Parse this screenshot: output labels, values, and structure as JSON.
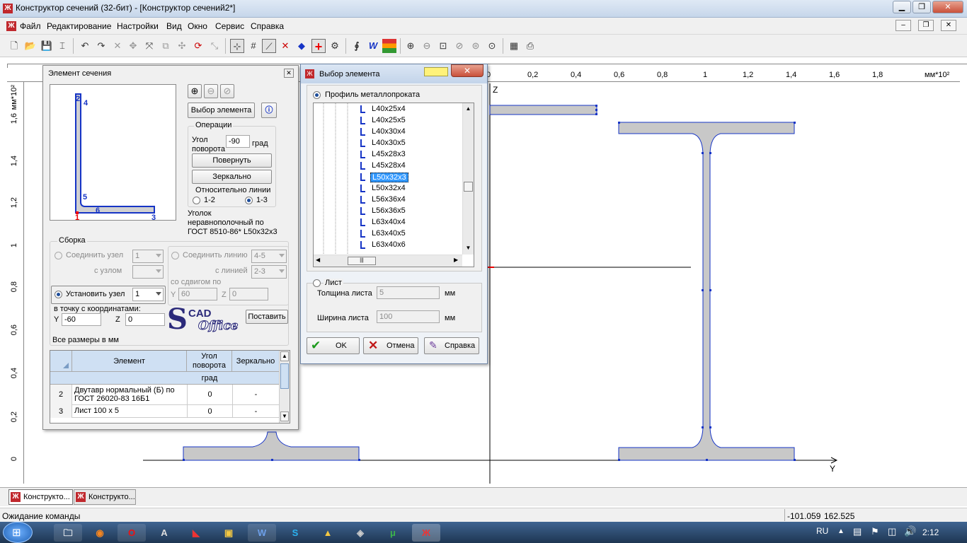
{
  "window": {
    "title": "Конструктор сечений (32-бит) - [Конструктор сечений2*]"
  },
  "menu": [
    "Файл",
    "Редактирование",
    "Настройки",
    "Вид",
    "Окно",
    "Сервис",
    "Справка"
  ],
  "ruler": {
    "x_ticks": [
      "0",
      "0,2",
      "0,4",
      "0,6",
      "0,8",
      "1",
      "1,2",
      "1,4",
      "1,6",
      "1,8"
    ],
    "x_unit": "мм*10²",
    "y_ticks": [
      "1,6",
      "1,4",
      "1,2",
      "1",
      "0,8",
      "0,6",
      "0,4",
      "0,2",
      "0"
    ],
    "y_unit": "мм*10²",
    "axis_z": "Z",
    "axis_y": "Y"
  },
  "element_panel": {
    "title": "Элемент сечения",
    "preview_nodes": [
      "2",
      "4",
      "5",
      "6",
      "1",
      "3"
    ],
    "select_button": "Выбор элемента",
    "operations_label": "Операции",
    "angle_label_1": "Угол",
    "angle_label_2": "поворота",
    "angle_value": "-90",
    "angle_unit": "град",
    "rotate_button": "Повернуть",
    "mirror_button": "Зеркально",
    "relative_label": "Относительно линии",
    "radio_12": "1-2",
    "radio_13": "1-3",
    "description_1": "Уголок",
    "description_2": "неравнополочный по",
    "description_3": "ГОСТ 8510-86* L50x32x3",
    "assembly_label": "Сборка",
    "join_node_label": "Соединить узел",
    "join_node_value": "1",
    "with_node_label": "с узлом",
    "join_line_label": "Соединить линию",
    "join_line_value": "4-5",
    "with_line_label": "с линией",
    "with_line_value": "2-3",
    "shift_label": "со сдвигом по",
    "shift_y_label": "Y",
    "shift_y_value": "60",
    "shift_z_label": "Z",
    "shift_z_value": "0",
    "set_node_label": "Установить узел",
    "set_node_value": "1",
    "to_point_label": "в точку с координатами:",
    "coord_y_label": "Y",
    "coord_y_value": "-60",
    "coord_z_label": "Z",
    "coord_z_value": "0",
    "logo_top": "CAD",
    "logo_bottom": "Office",
    "place_button": "Поставить",
    "sizes_note": "Все размеры в мм",
    "table": {
      "columns": [
        "Элемент",
        "Угол поворота",
        "Зеркально"
      ],
      "unit_row": "град",
      "rows": [
        {
          "num": "2",
          "element": "Двутавр нормальный (Б) по ГОСТ 26020-83  16Б1",
          "angle": "0",
          "mirror": "-"
        },
        {
          "num": "3",
          "element": "Лист 100 x 5",
          "angle": "0",
          "mirror": "-"
        }
      ]
    }
  },
  "select_dialog": {
    "title": "Выбор элемента",
    "profile_radio": "Профиль металлопроката",
    "tree_items": [
      "L40x25x4",
      "L40x25x5",
      "L40x30x4",
      "L40x30x5",
      "L45x28x3",
      "L45x28x4",
      "L50x32x3",
      "L50x32x4",
      "L56x36x4",
      "L56x36x5",
      "L63x40x4",
      "L63x40x5",
      "L63x40x6"
    ],
    "selected_item": "L50x32x3",
    "sheet_radio": "Лист",
    "thickness_label": "Толщина листа",
    "thickness_value": "5",
    "width_label": "Ширина листа",
    "width_value": "100",
    "unit_mm": "мм",
    "ok_button": "OK",
    "cancel_button": "Отмена",
    "help_button": "Справка"
  },
  "tabs": [
    "Конструкто...",
    "Конструкто..."
  ],
  "status": {
    "text": "Ожидание команды",
    "x": "-101.059",
    "y": "162.525"
  },
  "taskbar": {
    "lang": "RU",
    "time": "2:12"
  },
  "colors": {
    "accent_blue": "#1634c6",
    "section_fill": "#c8c8c8",
    "selection": "#3399ff",
    "app_red": "#c0282d"
  }
}
